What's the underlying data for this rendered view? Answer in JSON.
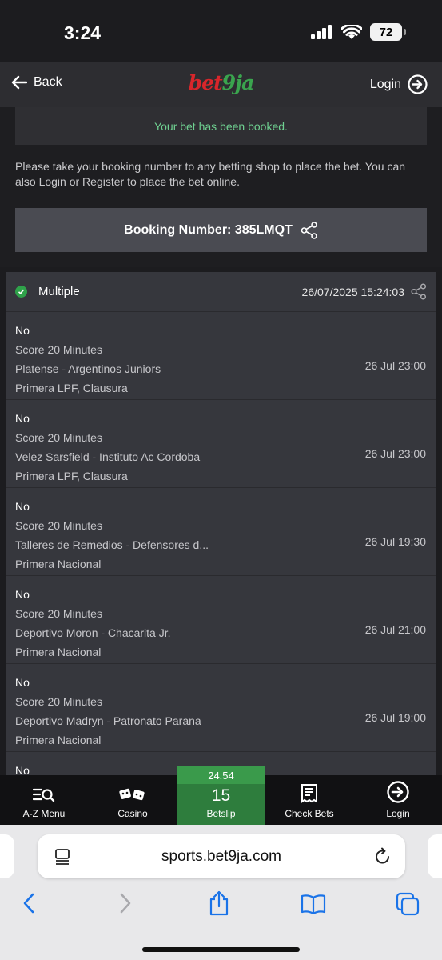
{
  "status": {
    "time": "3:24",
    "battery": "72"
  },
  "header": {
    "back_label": "Back",
    "logo_main": "bet",
    "logo_accent": "9ja",
    "login_label": "Login"
  },
  "booking": {
    "booked_message": "Your bet has been booked.",
    "instructions": "Please take your booking number to any betting shop to place the bet. You can also Login or Register to place the bet online.",
    "booking_number_label": "Booking Number: 385LMQT"
  },
  "bet": {
    "type": "Multiple",
    "datetime": "26/07/2025 15:24:03",
    "selections": [
      {
        "pick": "No",
        "market": "Score 20 Minutes",
        "match": "Platense - Argentinos Juniors",
        "league": "Primera LPF, Clausura",
        "kickoff": "26 Jul 23:00"
      },
      {
        "pick": "No",
        "market": "Score 20 Minutes",
        "match": "Velez Sarsfield - Instituto Ac Cordoba",
        "league": "Primera LPF, Clausura",
        "kickoff": "26 Jul 23:00"
      },
      {
        "pick": "No",
        "market": "Score 20 Minutes",
        "match": "Talleres de Remedios - Defensores d...",
        "league": "Primera Nacional",
        "kickoff": "26 Jul 19:30"
      },
      {
        "pick": "No",
        "market": "Score 20 Minutes",
        "match": "Deportivo Moron - Chacarita Jr.",
        "league": "Primera Nacional",
        "kickoff": "26 Jul 21:00"
      },
      {
        "pick": "No",
        "market": "Score 20 Minutes",
        "match": "Deportivo Madryn - Patronato Parana",
        "league": "Primera Nacional",
        "kickoff": "26 Jul 19:00"
      },
      {
        "pick": "No",
        "market": "",
        "match": "",
        "league": "",
        "kickoff": ""
      }
    ]
  },
  "bottom_nav": {
    "az_menu": "A-Z Menu",
    "casino": "Casino",
    "betslip_odds": "24.54",
    "betslip_count": "15",
    "betslip_label": "Betslip",
    "check_bets": "Check Bets",
    "login": "Login"
  },
  "browser": {
    "url": "sports.bet9ja.com"
  }
}
